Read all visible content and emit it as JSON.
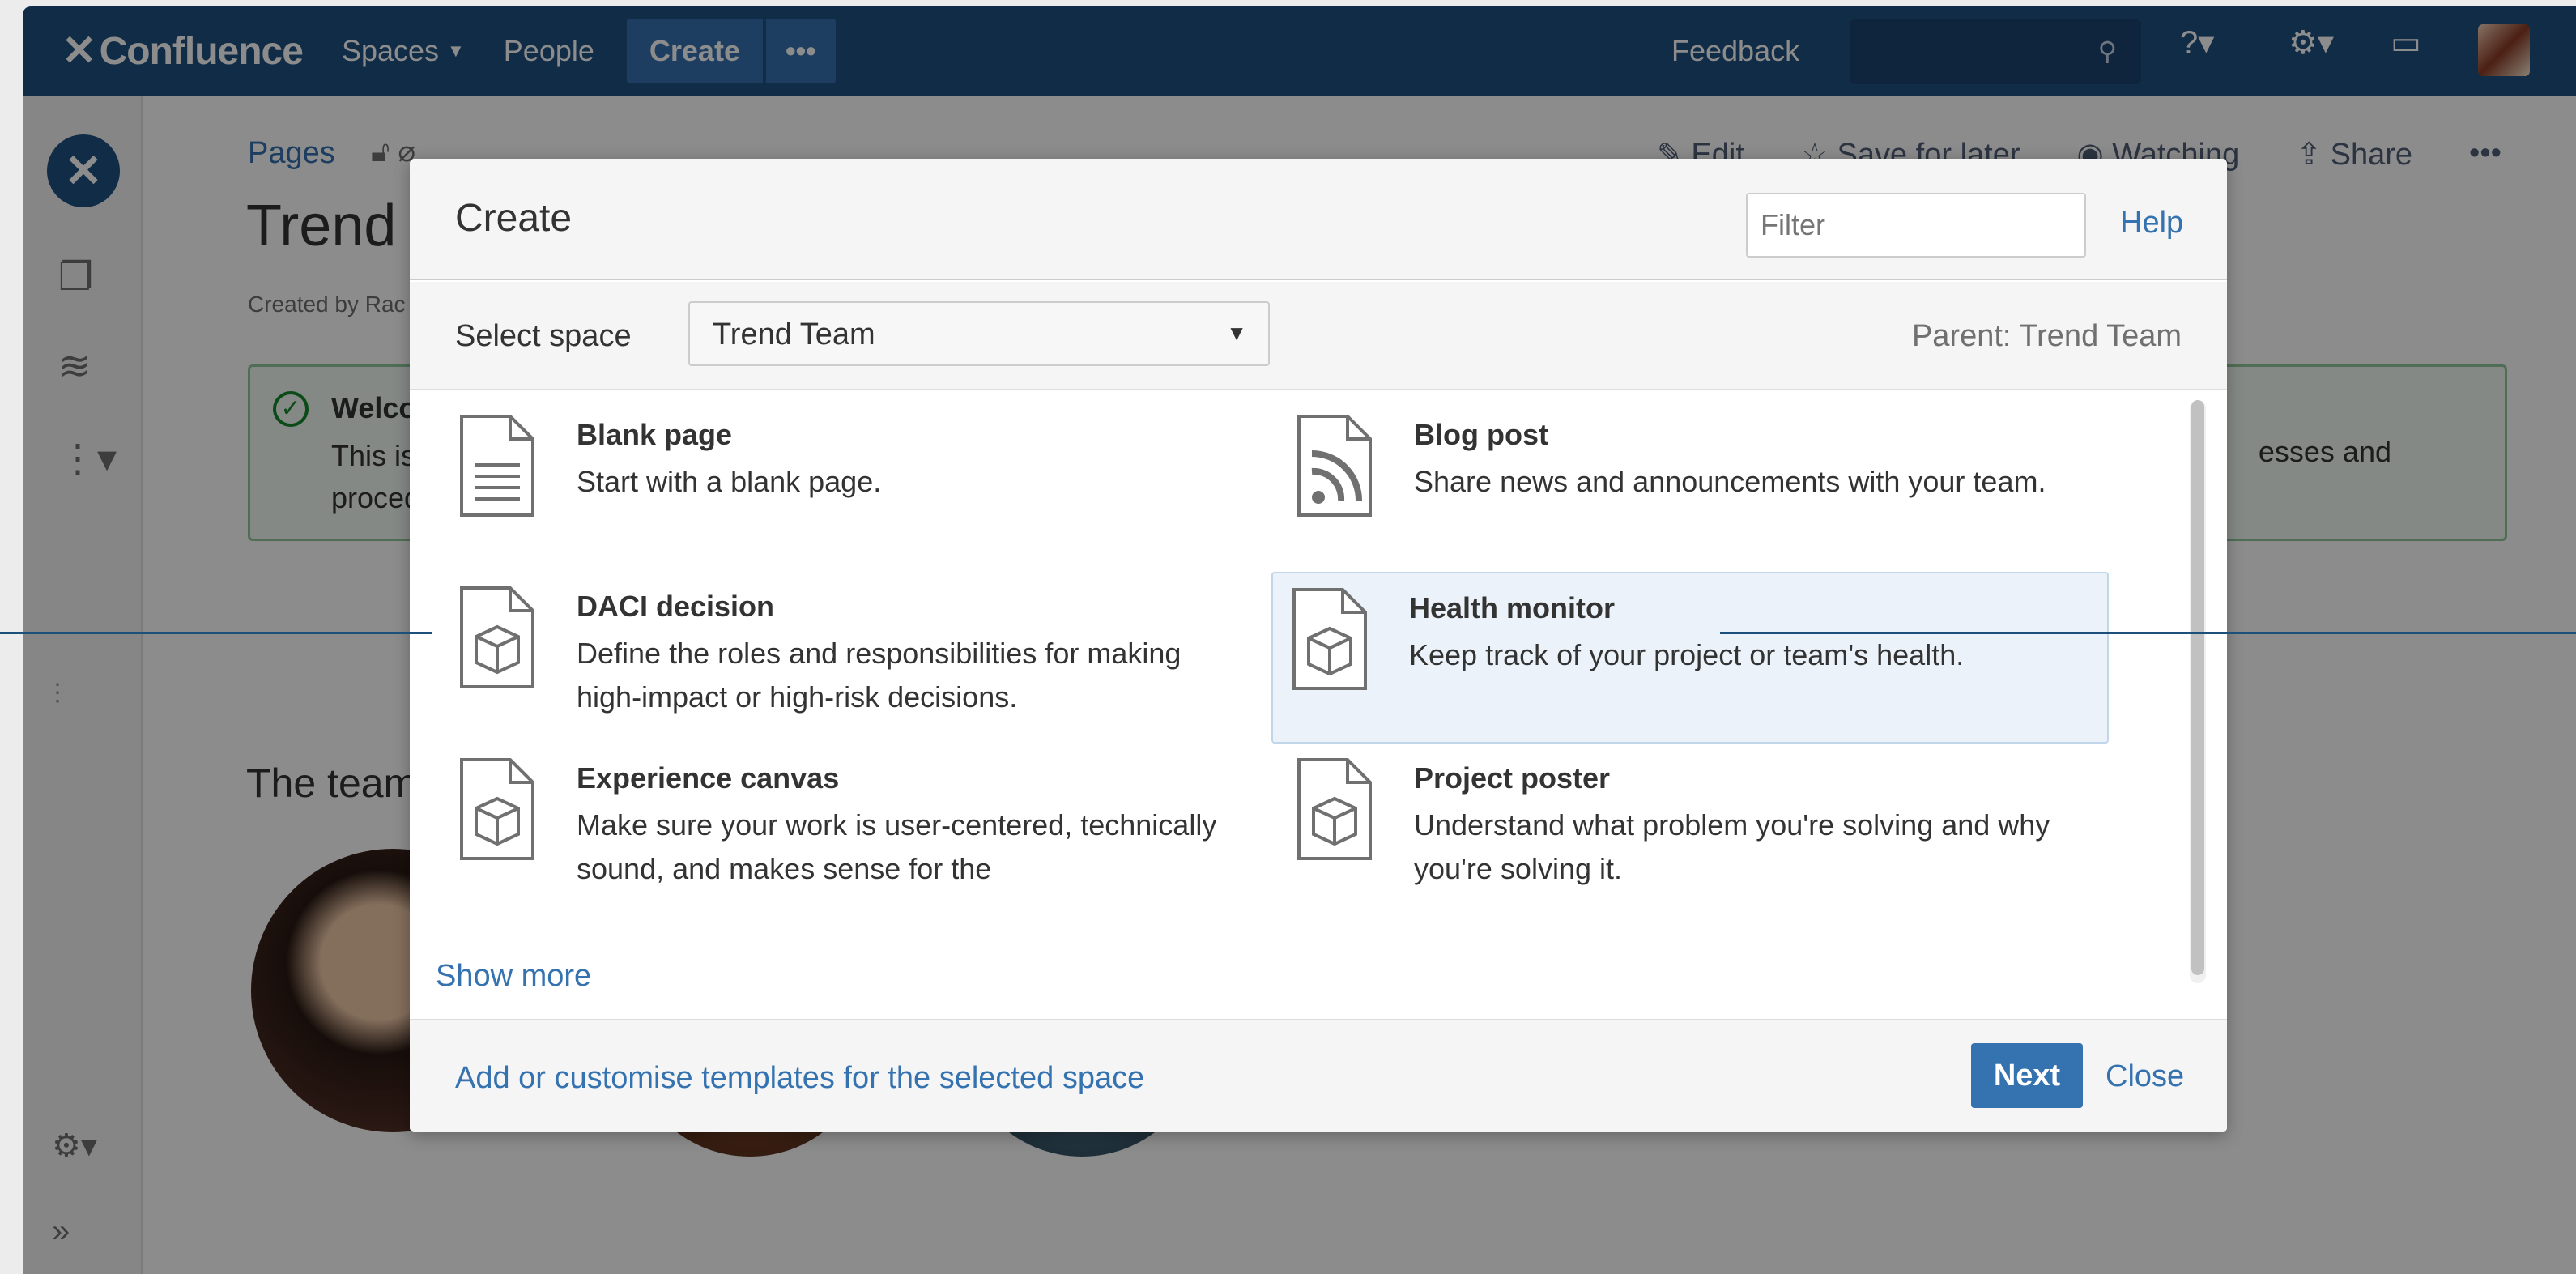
{
  "topnav": {
    "logo": "Confluence",
    "spaces": "Spaces",
    "people": "People",
    "create": "Create",
    "more": "•••",
    "feedback": "Feedback",
    "search_icon": "search-icon",
    "help_icon": "help-icon",
    "settings_icon": "gear-icon",
    "notifications_icon": "notifications-icon"
  },
  "page": {
    "breadcrumb": "Pages",
    "title": "Trend T",
    "created_by": "Created by Rac",
    "actions": {
      "edit": "Edit",
      "save_for_later": "Save for later",
      "watching": "Watching",
      "share": "Share",
      "more": "•••"
    },
    "info_panel": {
      "title": "Welcon",
      "body_line1": "This is t",
      "body_line2": "procedu",
      "tail": "esses and"
    },
    "team_heading": "The team"
  },
  "dialog": {
    "title": "Create",
    "filter_placeholder": "Filter",
    "help": "Help",
    "select_space_label": "Select space",
    "selected_space": "Trend Team",
    "parent": "Parent: Trend Team",
    "templates": [
      {
        "name": "Blank page",
        "description": "Start with a blank page.",
        "icon": "blank-page-icon"
      },
      {
        "name": "Blog post",
        "description": "Share news and announcements with your team.",
        "icon": "rss-icon"
      },
      {
        "name": "DACI decision",
        "description": "Define the roles and responsibilities for making high-impact or high-risk decisions.",
        "icon": "box-icon"
      },
      {
        "name": "Health monitor",
        "description": "Keep track of your project or team's health.",
        "icon": "box-icon",
        "selected": true
      },
      {
        "name": "Experience canvas",
        "description": "Make sure your work is user-centered, technically sound, and makes sense for the",
        "icon": "box-icon"
      },
      {
        "name": "Project poster",
        "description": "Understand what problem you're solving and why you're solving it.",
        "icon": "box-icon"
      }
    ],
    "show_more": "Show more",
    "customise": "Add or customise templates for the selected space",
    "next": "Next",
    "close": "Close"
  },
  "colors": {
    "nav": "#205081",
    "accent": "#3572b0",
    "selected_bg": "#ebf2f9"
  }
}
